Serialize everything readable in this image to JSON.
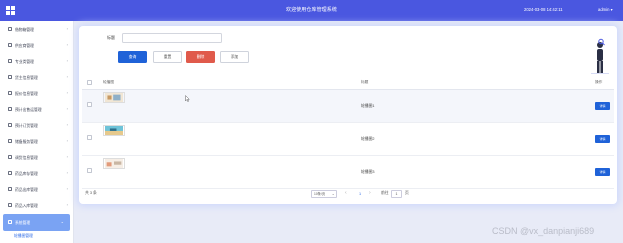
{
  "app": {
    "title": "欢迎使用仓库管理系统",
    "datetime": "2024-03-08 14:42:11",
    "user": "admin"
  },
  "sidebar": {
    "items": [
      {
        "label": "借物箱管理"
      },
      {
        "label": "供应商管理"
      },
      {
        "label": "专业类管理"
      },
      {
        "label": "货主信息管理"
      },
      {
        "label": "报价信息管理"
      },
      {
        "label": "预计出售运管理"
      },
      {
        "label": "预计订货管理"
      },
      {
        "label": "储备服务管理"
      },
      {
        "label": "调货信息管理"
      },
      {
        "label": "药品库存管理"
      },
      {
        "label": "药品出库管理"
      },
      {
        "label": "药品入库管理"
      },
      {
        "label": "系统管理",
        "active": true
      }
    ],
    "submenu_label": "轮播图管理"
  },
  "search": {
    "label": "标题",
    "placeholder": ""
  },
  "toolbar": {
    "search_label": "查询",
    "reset_label": "重置",
    "delete_label": "删除",
    "add_label": "添加"
  },
  "table": {
    "headers": [
      "轮播图",
      "标题",
      "操作"
    ],
    "rows": [
      {
        "title": "轮播图1",
        "action": "详情"
      },
      {
        "title": "轮播图2",
        "action": "详情"
      },
      {
        "title": "轮播图3",
        "action": "详情"
      }
    ]
  },
  "pagination": {
    "total": "共 3 条",
    "page_size": "10条/页",
    "current_page": "1",
    "goto_prefix": "前往",
    "goto_value": "1",
    "goto_suffix": "页",
    "prev": "‹",
    "next": "›"
  },
  "watermark": "CSDN @vx_danpianji689",
  "colors": {
    "topbar": "#4a57e0",
    "primary": "#1f62d8",
    "danger": "#e05a4b",
    "sidebar_active": "#7aa3f3"
  }
}
